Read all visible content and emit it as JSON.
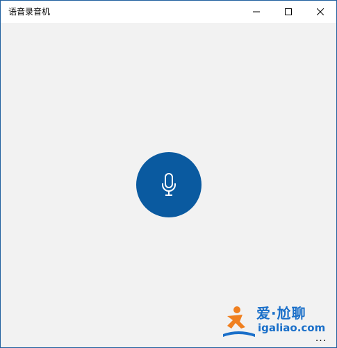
{
  "window": {
    "title": "语音录音机"
  },
  "controls": {
    "minimize_icon": "minimize-icon",
    "maximize_icon": "maximize-icon",
    "close_icon": "close-icon"
  },
  "record": {
    "icon": "microphone-icon",
    "color": "#0a5aa0"
  },
  "watermark": {
    "line1": "爱·尬聊",
    "line2": "igaliao.com"
  },
  "more": {
    "label": "..."
  }
}
